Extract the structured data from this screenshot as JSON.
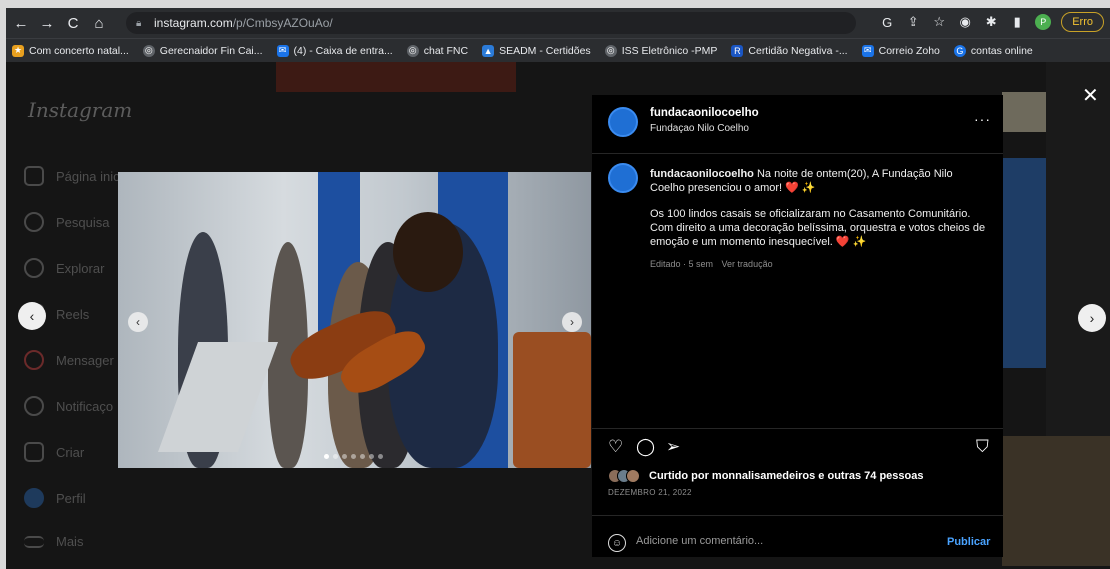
{
  "browser": {
    "url_host": "instagram.com",
    "url_path": "/p/CmbsyAZOuAo/",
    "erro_label": "Erro",
    "profile_initial": "P"
  },
  "bookmarks": [
    {
      "label": "Com concerto natal..."
    },
    {
      "label": "Gerecnaidor Fin Cai..."
    },
    {
      "label": "(4) - Caixa de entra..."
    },
    {
      "label": "chat FNC"
    },
    {
      "label": "SEADM - Certidões"
    },
    {
      "label": "ISS Eletrônico -PMP"
    },
    {
      "label": "Certidão Negativa -..."
    },
    {
      "label": "Correio Zoho"
    },
    {
      "label": "contas online"
    }
  ],
  "instagram": {
    "logo": "Instagram",
    "sidebar": [
      {
        "label": "Página inic"
      },
      {
        "label": "Pesquisa"
      },
      {
        "label": "Explorar"
      },
      {
        "label": "Reels"
      },
      {
        "label": "Mensager"
      },
      {
        "label": "Notificaço"
      },
      {
        "label": "Criar"
      },
      {
        "label": "Perfil"
      },
      {
        "label": "Mais"
      }
    ]
  },
  "post": {
    "username": "fundacaonilocoelho",
    "subtitle": "Fundaçao Nilo Coelho",
    "caption_line1": " Na noite de ontem(20), A Fundação Nilo Coelho presenciou o amor! ❤️ ✨",
    "caption_line2": "Os 100 lindos casais se oficializaram no Casamento Comunitário. Com direito a uma decoração belíssima, orquestra e votos cheios de emoção e um momento inesquecível. ❤️ ✨",
    "edited": "Editado · 5 sem",
    "see_translation": "Ver tradução",
    "likes_text": "Curtido por monnalisamedeiros e outras 74 pessoas",
    "date": "DEZEMBRO 21, 2022",
    "comment_placeholder": "Adicione um comentário...",
    "publish_label": "Publicar",
    "more_label": "···"
  },
  "colors": {
    "accent_blue": "#4aa3ff",
    "heart_red": "#e0245e"
  }
}
